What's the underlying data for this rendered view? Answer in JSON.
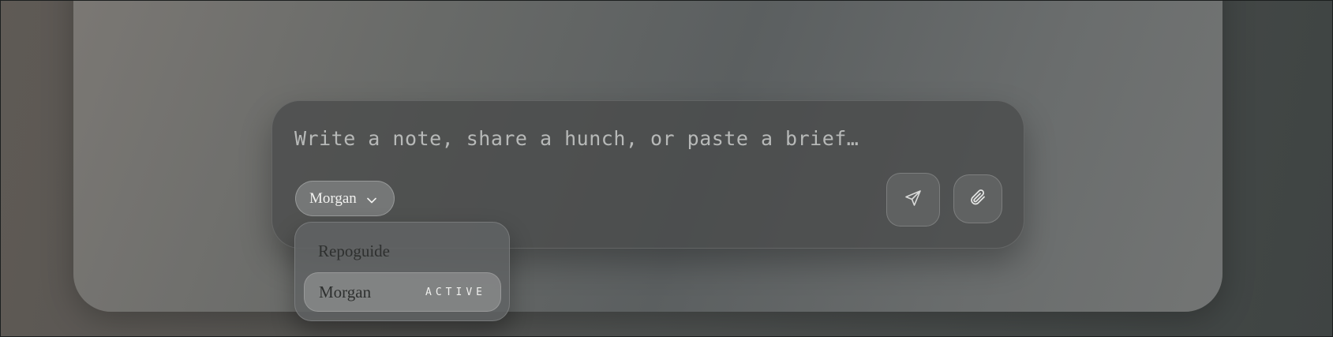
{
  "composer": {
    "placeholder": "Write a note, share a hunch, or paste a brief…",
    "persona_selected": "Morgan",
    "send_icon": "send-icon",
    "attach_icon": "paperclip-icon"
  },
  "persona_menu": {
    "items": [
      {
        "label": "Repoguide",
        "badge": ""
      },
      {
        "label": "Morgan",
        "badge": "ACTIVE"
      }
    ]
  }
}
